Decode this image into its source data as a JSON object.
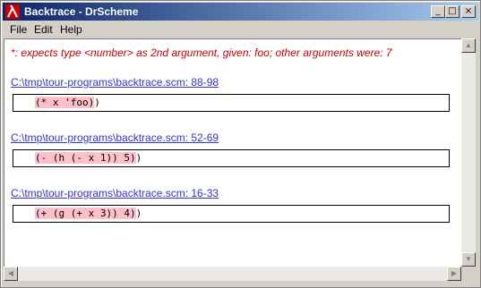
{
  "window": {
    "title": "Backtrace - DrScheme",
    "minimize_glyph": "_",
    "maximize_glyph": "□",
    "close_glyph": "×"
  },
  "menu": [
    "File",
    "Edit",
    "Help"
  ],
  "error_message": "*: expects type <number> as 2nd argument, given: foo; other arguments were: 7",
  "frames": [
    {
      "location": "C:\\tmp\\tour-programs\\backtrace.scm: 88-98",
      "code_highlighted": "(* x 'foo)",
      "code_rest": ")"
    },
    {
      "location": "C:\\tmp\\tour-programs\\backtrace.scm: 52-69",
      "code_highlighted": "(- (h (- x 1)) 5)",
      "code_rest": ")"
    },
    {
      "location": "C:\\tmp\\tour-programs\\backtrace.scm: 16-33",
      "code_highlighted": "(+ (g (+ x 3)) 4)",
      "code_rest": ")"
    }
  ],
  "colors": {
    "error_text": "#cc0000",
    "link": "#3333cc",
    "highlight": "#ffc0cb",
    "titlebar_start": "#0a246a",
    "titlebar_end": "#a6caf0"
  },
  "icons": {
    "app": "drscheme-lambda-icon",
    "scroll_up": "arrow-up-icon",
    "scroll_down": "arrow-down-icon",
    "scroll_left": "arrow-left-icon",
    "scroll_right": "arrow-right-icon"
  }
}
